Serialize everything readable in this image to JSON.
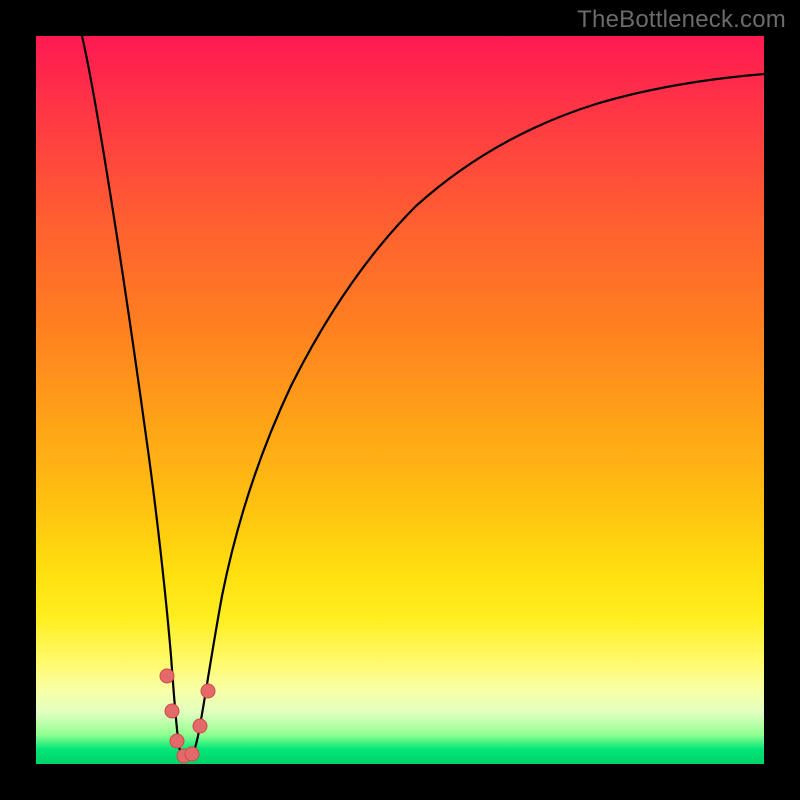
{
  "watermark": "TheBottleneck.com",
  "colors": {
    "frame": "#000000",
    "curve": "#000000",
    "dot": "#e46a6a",
    "gradient_top": "#ff1a52",
    "gradient_bottom": "#00d26a"
  },
  "chart_data": {
    "type": "line",
    "title": "",
    "xlabel": "",
    "ylabel": "",
    "xlim": [
      0,
      100
    ],
    "ylim": [
      0,
      100
    ],
    "x": [
      0,
      2,
      4,
      6,
      8,
      10,
      12,
      14,
      16,
      17,
      18,
      18.5,
      19,
      19.5,
      20,
      20.5,
      21,
      22,
      24,
      26,
      28,
      30,
      34,
      38,
      42,
      46,
      50,
      55,
      60,
      65,
      70,
      75,
      80,
      85,
      90,
      95,
      100
    ],
    "y": [
      100,
      94,
      85,
      76,
      67,
      58,
      49,
      39,
      28,
      20,
      13,
      7,
      3,
      1,
      0.5,
      1,
      3,
      7,
      15,
      23,
      30,
      36,
      46,
      54,
      60,
      65,
      69,
      73,
      76.5,
      79.5,
      82,
      84,
      86,
      87.5,
      89,
      90.3,
      91.5
    ],
    "markers": {
      "x": [
        17.0,
        17.8,
        18.8,
        19.6,
        20.6,
        21.6,
        22.6
      ],
      "y": [
        13,
        7,
        2,
        1,
        2,
        7,
        13
      ]
    },
    "notes": "Bottleneck curve; vertical axis is mismatch percentage (top=100% red, bottom=0% green). Minimum ≈ x=20. No numeric axis labels are rendered in the image."
  }
}
